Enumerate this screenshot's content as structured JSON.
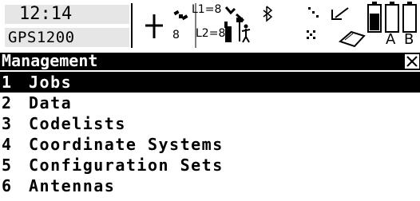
{
  "status_bar": {
    "time": "12:14",
    "device": "GPS1200",
    "l1_label": "L1=",
    "l1_value": "8",
    "l2_label": "L2=",
    "l2_value": "8",
    "sat_count": "8",
    "battery_labels": [
      "A",
      "B"
    ]
  },
  "screen": {
    "title": "Management",
    "close_symbol": "×"
  },
  "menu": {
    "items": [
      {
        "num": "1",
        "label": "Jobs",
        "selected": true
      },
      {
        "num": "2",
        "label": "Data"
      },
      {
        "num": "3",
        "label": "Codelists"
      },
      {
        "num": "4",
        "label": "Coordinate Systems"
      },
      {
        "num": "5",
        "label": "Configuration Sets"
      },
      {
        "num": "6",
        "label": "Antennas"
      }
    ]
  }
}
